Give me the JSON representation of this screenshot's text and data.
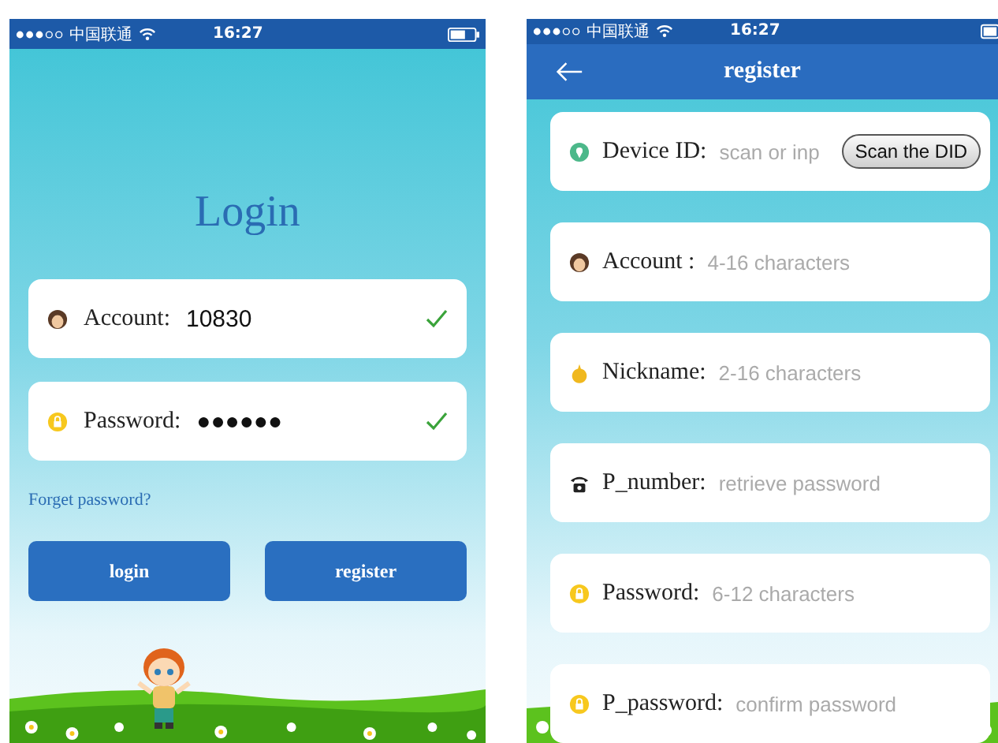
{
  "login_screen": {
    "status_bar": {
      "carrier": "中国联通",
      "time": "16:27"
    },
    "title": "Login",
    "fields": [
      {
        "kind": "account",
        "label": "Account:",
        "value": "10830",
        "valid": true
      },
      {
        "kind": "password",
        "label": "Password:",
        "value": "●●●●●●",
        "valid": true
      }
    ],
    "forgot_link": "Forget password?",
    "buttons": [
      "login",
      "register"
    ]
  },
  "register_screen": {
    "status_bar": {
      "carrier": "中国联通",
      "time": "16:27"
    },
    "title": "register",
    "fields": [
      {
        "kind": "device",
        "label": "Device ID:",
        "placeholder": "scan or inp",
        "button": "Scan the DID"
      },
      {
        "kind": "account",
        "label": "Account :",
        "placeholder": "4-16 characters"
      },
      {
        "kind": "nickname",
        "label": "Nickname:",
        "placeholder": "2-16 characters"
      },
      {
        "kind": "phone",
        "label": "P_number:",
        "placeholder": "retrieve password"
      },
      {
        "kind": "password",
        "label": "Password:",
        "placeholder": "6-12 characters"
      },
      {
        "kind": "password",
        "label": "P_password:",
        "placeholder": "confirm password"
      }
    ]
  }
}
